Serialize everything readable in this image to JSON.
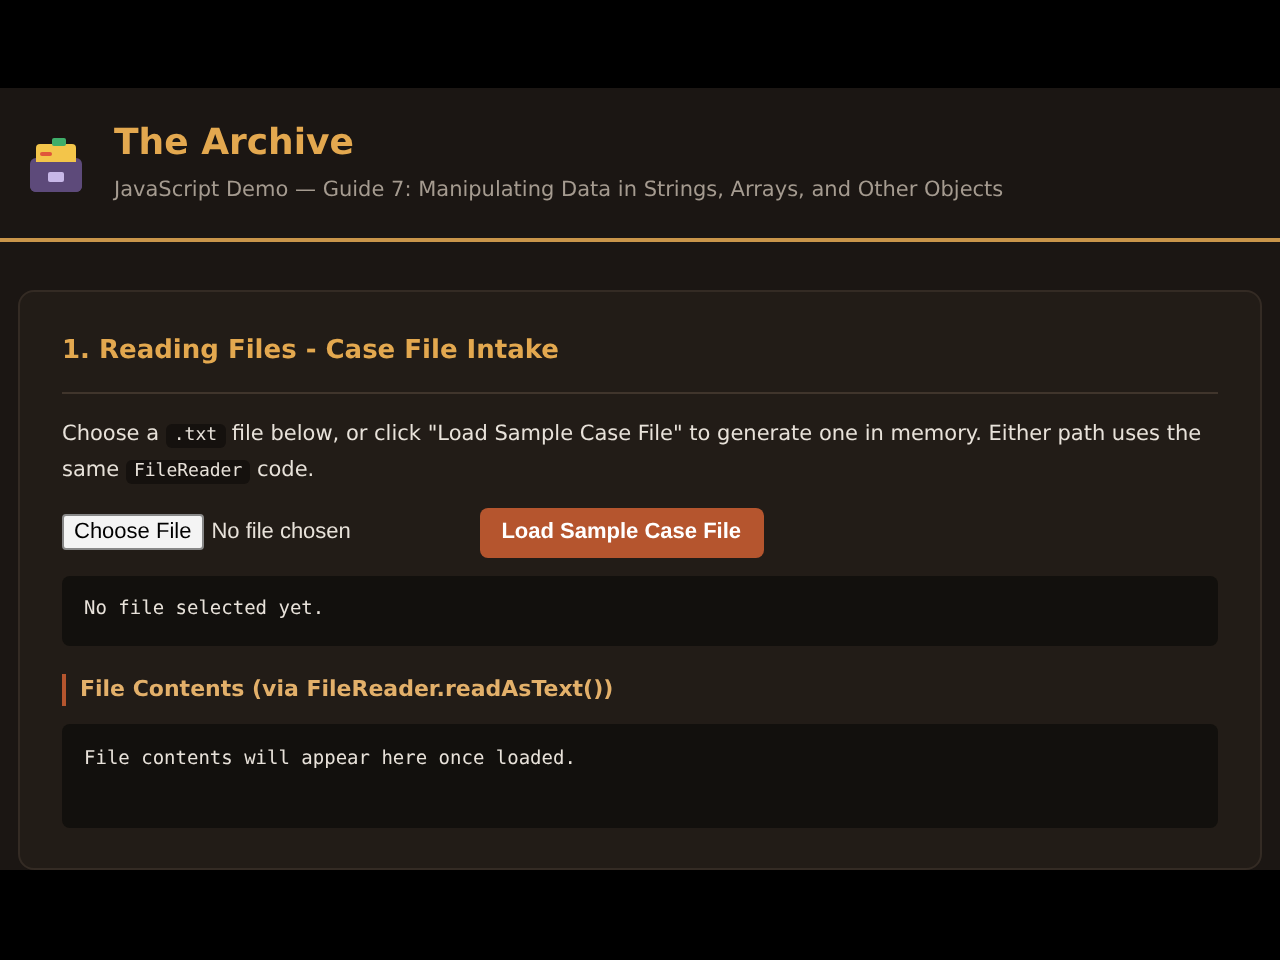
{
  "header": {
    "title": "The Archive",
    "subtitle": "JavaScript Demo — Guide 7: Manipulating Data in Strings, Arrays, and Other Objects"
  },
  "section": {
    "title": "1. Reading Files - Case File Intake",
    "intro": [
      {
        "kind": "text",
        "text": "Choose a "
      },
      {
        "kind": "code",
        "text": ".txt"
      },
      {
        "kind": "text",
        "text": " file below, or click \"Load Sample Case File\" to generate one in memory. Either path uses the same "
      },
      {
        "kind": "code",
        "text": "FileReader"
      },
      {
        "kind": "text",
        "text": " code."
      }
    ],
    "file_input": {
      "button": "Choose File",
      "status": "No file chosen"
    },
    "load_button": "Load Sample Case File",
    "status_output": "No file selected yet.",
    "contents_heading": "File Contents (via FileReader.readAsText())",
    "contents_output": "File contents will appear here once loaded."
  }
}
